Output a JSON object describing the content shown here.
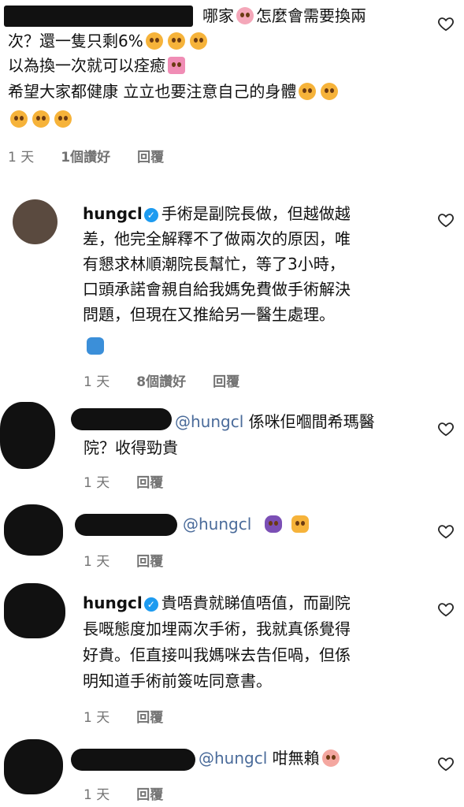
{
  "comments": [
    {
      "lines": [
        "哪家",
        "怎麼會需要換兩",
        "次？還一隻只剩6%",
        "以為換一次就可以痊癒",
        "希望大家都健康 立立也要注意自己的身體"
      ],
      "time": "1 天",
      "likes": "1個讚好",
      "reply": "回覆"
    },
    {
      "username": "hungcl",
      "lines": [
        "手術是副院長做，但越做越",
        "差，他完全解釋不了做兩次的原因，唯",
        "有懇求林順潮院長幫忙，等了3小時，",
        "口頭承諾會親自給我媽免費做手術解決",
        "問題，但現在又推給另一醫生處理。"
      ],
      "time": "1 天",
      "likes": "8個讚好",
      "reply": "回覆"
    },
    {
      "mention": "@hungcl",
      "lines": [
        "係咪佢嗰間希瑪醫",
        "院？收得勁貴"
      ],
      "time": "1 天",
      "reply": "回覆"
    },
    {
      "mention": "@hungcl",
      "time": "1 天",
      "reply": "回覆"
    },
    {
      "username": "hungcl",
      "lines": [
        "貴唔貴就睇值唔值，而副院",
        "長嘅態度加埋兩次手術，我就真係覺得",
        "好貴。佢直接叫我媽咪去告佢喎，但係",
        "明知道手術前簽咗同意書。"
      ],
      "time": "1 天",
      "reply": "回覆"
    },
    {
      "mention": "@hungcl",
      "lines": [
        "咁無賴"
      ],
      "time": "1 天",
      "reply": "回覆"
    }
  ]
}
